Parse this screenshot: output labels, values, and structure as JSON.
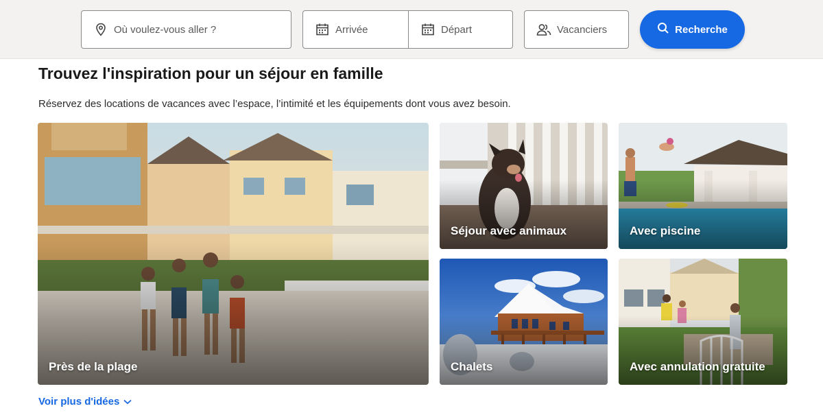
{
  "search": {
    "destination_placeholder": "Où voulez-vous aller ?",
    "arrival_placeholder": "Arrivée",
    "departure_placeholder": "Départ",
    "travelers_placeholder": "Vacanciers",
    "button_label": "Recherche"
  },
  "section": {
    "title": "Trouvez l'inspiration pour un séjour en famille",
    "subtitle": "Réservez des locations de vacances avec l’espace, l’intimité et les équipements dont vous avez besoin."
  },
  "cards": [
    {
      "label": "Près de la plage",
      "icon": "beach-house-photo"
    },
    {
      "label": "Séjour avec animaux",
      "icon": "dog-photo"
    },
    {
      "label": "Avec piscine",
      "icon": "pool-photo"
    },
    {
      "label": "Chalets",
      "icon": "chalet-photo"
    },
    {
      "label": "Avec annulation gratuite",
      "icon": "family-garden-photo"
    }
  ],
  "more_link": "Voir plus d'idées",
  "colors": {
    "accent": "#1668e3",
    "bar_background": "#f3f2f0"
  }
}
